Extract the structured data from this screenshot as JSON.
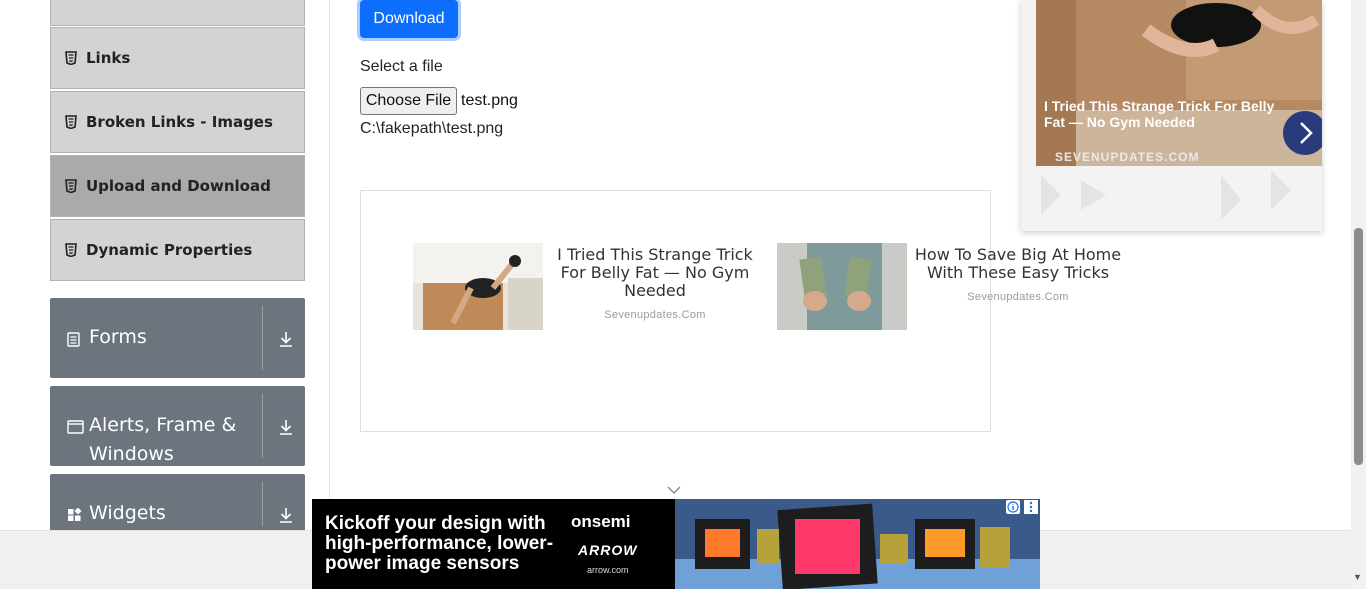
{
  "sidebar": {
    "items": [
      {
        "label": "Links"
      },
      {
        "label": "Broken Links - Images"
      },
      {
        "label": "Upload and Download"
      },
      {
        "label": "Dynamic Properties"
      }
    ],
    "groups": [
      {
        "label": "Forms"
      },
      {
        "label_line1": "Alerts, Frame &",
        "label_line2": "Windows"
      },
      {
        "label": "Widgets"
      }
    ]
  },
  "main": {
    "download_label": "Download",
    "select_file_label": "Select a file",
    "choose_file_label": "Choose File",
    "file_name": "test.png",
    "uploaded_path": "C:\\fakepath\\test.png"
  },
  "ads": {
    "cards": [
      {
        "title": "I Tried This Strange Trick For Belly Fat — No Gym Needed",
        "source": "Sevenupdates.Com"
      },
      {
        "title": "How To Save Big At Home With These Easy Tricks",
        "source": "Sevenupdates.Com"
      }
    ],
    "right": {
      "title": "I Tried This Strange Trick For Belly Fat — No Gym Needed",
      "source": "SEVENUPDATES.COM"
    },
    "banner": {
      "text": "Kickoff your design with high-performance, lower-power image sensors",
      "brand1": "onsemi",
      "brand2": "ARROW",
      "brand2_url": "arrow.com"
    }
  },
  "colors": {
    "primary": "#0d6efd",
    "group_bg": "#6c757d",
    "active_item": "#aaaaaa",
    "item_bg": "#d3d3d3"
  }
}
